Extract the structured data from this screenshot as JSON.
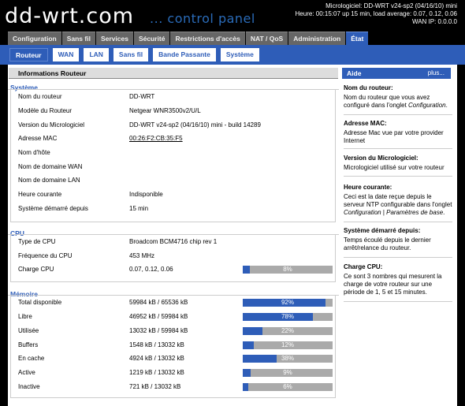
{
  "header": {
    "logo_main": "dd-wrt.com",
    "logo_sub": "... control panel",
    "firmware_line": "Micrologiciel: DD-WRT v24-sp2 (04/16/10) mini",
    "time_line": "Heure: 00:15:07 up 15 min, load average: 0.07, 0.12, 0.06",
    "wan_ip_line": "WAN IP: 0.0.0.0"
  },
  "main_tabs": [
    {
      "label": "Configuration"
    },
    {
      "label": "Sans fil"
    },
    {
      "label": "Services"
    },
    {
      "label": "Sécurité"
    },
    {
      "label": "Restrictions d'accès"
    },
    {
      "label": "NAT / QoS"
    },
    {
      "label": "Administration"
    },
    {
      "label": "État"
    }
  ],
  "sub_tabs": [
    {
      "label": "Routeur"
    },
    {
      "label": "WAN"
    },
    {
      "label": "LAN"
    },
    {
      "label": "Sans fil"
    },
    {
      "label": "Bande Passante"
    },
    {
      "label": "Système"
    }
  ],
  "page_title": "Informations Routeur",
  "system": {
    "title": "Système",
    "rows": [
      {
        "label": "Nom du routeur",
        "value": "DD-WRT"
      },
      {
        "label": "Modèle du Routeur",
        "value": "Netgear WNR3500v2/U/L"
      },
      {
        "label": "Version du Micrologiciel",
        "value": "DD-WRT v24-sp2 (04/16/10) mini - build 14289"
      },
      {
        "label": "Adresse MAC",
        "value": "00:26:F2:CB:35:F5"
      },
      {
        "label": "Nom d'hôte",
        "value": ""
      },
      {
        "label": "Nom de domaine WAN",
        "value": ""
      },
      {
        "label": "Nom de domaine LAN",
        "value": ""
      },
      {
        "label": "Heure courante",
        "value": "Indisponible"
      },
      {
        "label": "Système démarré depuis",
        "value": "15 min"
      }
    ]
  },
  "cpu": {
    "title": "CPU",
    "rows": [
      {
        "label": "Type de CPU",
        "value": "Broadcom BCM4716 chip rev 1"
      },
      {
        "label": "Fréquence du CPU",
        "value": "453 MHz"
      },
      {
        "label": "Charge CPU",
        "value": "0.07, 0.12, 0.06",
        "percent": 8,
        "percent_label": "8%"
      }
    ]
  },
  "memory": {
    "title": "Mémoire",
    "rows": [
      {
        "label": "Total disponible",
        "value": "59984 kB / 65536 kB",
        "percent": 92,
        "percent_label": "92%"
      },
      {
        "label": "Libre",
        "value": "46952 kB / 59984 kB",
        "percent": 78,
        "percent_label": "78%"
      },
      {
        "label": "Utilisée",
        "value": "13032 kB / 59984 kB",
        "percent": 22,
        "percent_label": "22%"
      },
      {
        "label": "Buffers",
        "value": "1548 kB / 13032 kB",
        "percent": 12,
        "percent_label": "12%"
      },
      {
        "label": "En cache",
        "value": "4924 kB / 13032 kB",
        "percent": 38,
        "percent_label": "38%"
      },
      {
        "label": "Active",
        "value": "1219 kB / 13032 kB",
        "percent": 9,
        "percent_label": "9%"
      },
      {
        "label": "Inactive",
        "value": "721 kB / 13032 kB",
        "percent": 6,
        "percent_label": "6%"
      }
    ]
  },
  "help": {
    "title": "Aide",
    "more": "plus...",
    "items": [
      {
        "title": "Nom du routeur:",
        "desc_pre": "Nom du routeur que vous avez configuré dans l'onglet ",
        "desc_em": "Configuration",
        "desc_post": "."
      },
      {
        "title": "Adresse MAC:",
        "desc_pre": "Adresse Mac vue par votre provider Internet",
        "desc_em": "",
        "desc_post": ""
      },
      {
        "title": "Version du Micrologiciel:",
        "desc_pre": "Micrologiciel utilisé sur votre routeur",
        "desc_em": "",
        "desc_post": ""
      },
      {
        "title": "Heure courante:",
        "desc_pre": "Ceci est la date reçue depuis le serveur NTP configurable dans l'onglet ",
        "desc_em": "Configuration | Paramètres de base",
        "desc_post": "."
      },
      {
        "title": "Système démarré depuis:",
        "desc_pre": "Temps écoulé depuis le dernier arrêt/relance du routeur.",
        "desc_em": "",
        "desc_post": ""
      },
      {
        "title": "Charge CPU:",
        "desc_pre": "Ce sont 3 nombres qui mesurent la charge de votre routeur sur une période de 1, 5 et 15 minutes.",
        "desc_em": "",
        "desc_post": ""
      }
    ]
  },
  "colors": {
    "accent": "#2e5db8",
    "bar_bg": "#aaaaaa",
    "tab_bg": "#666666"
  }
}
